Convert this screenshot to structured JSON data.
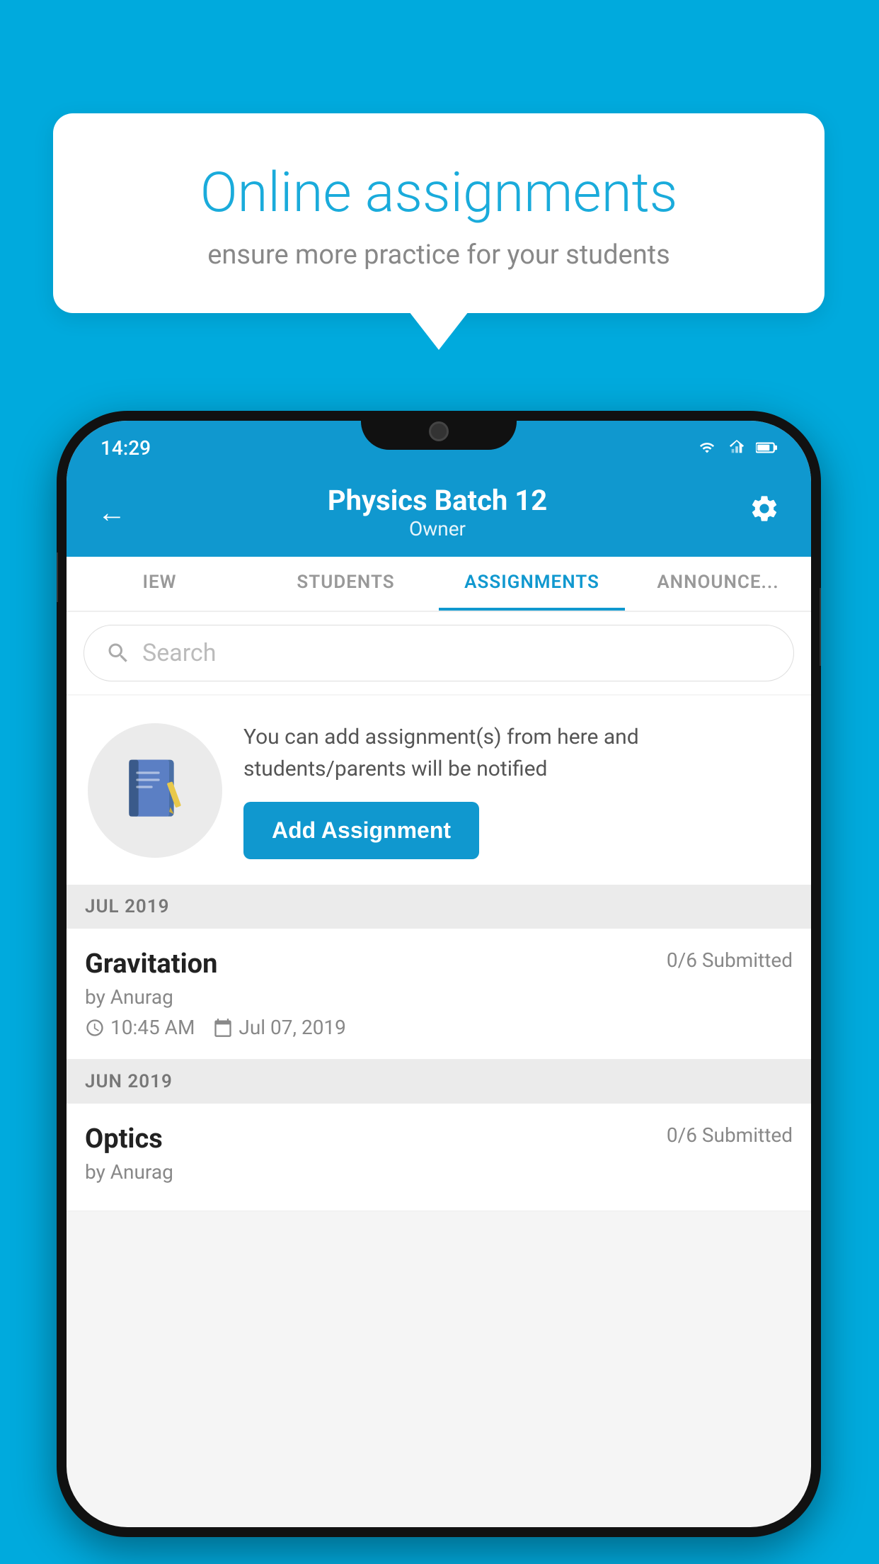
{
  "background_color": "#00AADD",
  "speech_bubble": {
    "title": "Online assignments",
    "subtitle": "ensure more practice for your students"
  },
  "phone": {
    "status_bar": {
      "time": "14:29"
    },
    "header": {
      "title": "Physics Batch 12",
      "subtitle": "Owner",
      "back_label": "←",
      "settings_label": "⚙"
    },
    "tabs": [
      {
        "label": "IEW",
        "active": false
      },
      {
        "label": "STUDENTS",
        "active": false
      },
      {
        "label": "ASSIGNMENTS",
        "active": true
      },
      {
        "label": "ANNOUNCE...",
        "active": false
      }
    ],
    "search": {
      "placeholder": "Search"
    },
    "promo": {
      "text": "You can add assignment(s) from here and students/parents will be notified",
      "button_label": "Add Assignment"
    },
    "sections": [
      {
        "header": "JUL 2019",
        "assignments": [
          {
            "name": "Gravitation",
            "submitted": "0/6 Submitted",
            "author": "by Anurag",
            "time": "10:45 AM",
            "date": "Jul 07, 2019"
          }
        ]
      },
      {
        "header": "JUN 2019",
        "assignments": [
          {
            "name": "Optics",
            "submitted": "0/6 Submitted",
            "author": "by Anurag",
            "time": "",
            "date": ""
          }
        ]
      }
    ]
  }
}
